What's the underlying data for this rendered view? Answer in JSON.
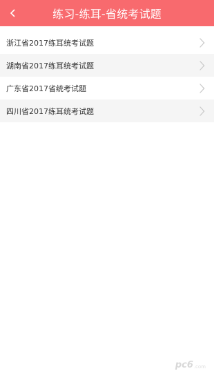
{
  "header": {
    "title": "练习-练耳-省统考试题",
    "back_icon": "chevron-left-icon",
    "background_color": "#f86a6e"
  },
  "exam_list": {
    "items": [
      {
        "label": "浙江省2017练耳统考试题"
      },
      {
        "label": "湖南省2017练耳统考试题"
      },
      {
        "label": "广东省2017省统考试题"
      },
      {
        "label": "四川省2017练耳统考试题"
      }
    ],
    "row_icon": "chevron-right-icon",
    "alt_row_color": "#f5f5f5"
  },
  "watermark": {
    "logo_text": "pc6",
    "sub_text": ".com"
  }
}
